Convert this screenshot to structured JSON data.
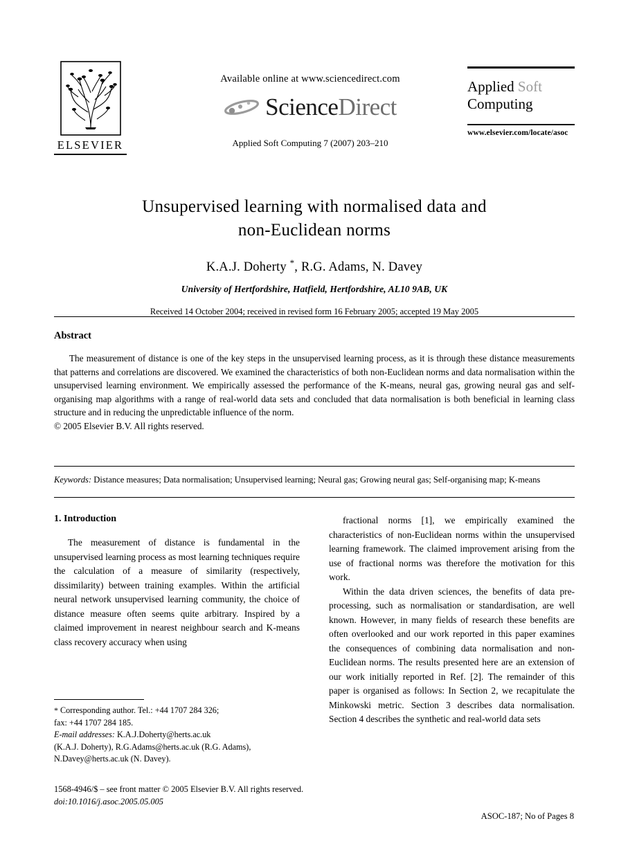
{
  "header": {
    "publisher": "ELSEVIER",
    "available_online": "Available online at www.sciencedirect.com",
    "sciencedirect_science": "Science",
    "sciencedirect_direct": "Direct",
    "journal_line": "Applied Soft Computing 7 (2007) 203–210",
    "journal_title_line1_bold": "Applied ",
    "journal_title_line1_grey": "Soft",
    "journal_title_line2": "Computing",
    "journal_url": "www.elsevier.com/locate/asoc"
  },
  "title": {
    "line1": "Unsupervised learning with normalised data and",
    "line2": "non-Euclidean norms"
  },
  "authors": {
    "text_before_star": "K.A.J. Doherty ",
    "star": "*",
    "text_after_star": ", R.G. Adams, N. Davey",
    "affiliation": "University of Hertfordshire, Hatfield, Hertfordshire, AL10 9AB, UK",
    "received": "Received 14 October 2004; received in revised form 16 February 2005; accepted 19 May 2005"
  },
  "abstract": {
    "heading": "Abstract",
    "body": "The measurement of distance is one of the key steps in the unsupervised learning process, as it is through these distance measurements that patterns and correlations are discovered. We examined the characteristics of both non-Euclidean norms and data normalisation within the unsupervised learning environment. We empirically assessed the performance of the K-means, neural gas, growing neural gas and self-organising map algorithms with a range of real-world data sets and concluded that data normalisation is both beneficial in learning class structure and in reducing the unpredictable influence of the norm.",
    "copyright": "© 2005 Elsevier B.V. All rights reserved."
  },
  "keywords": {
    "label": "Keywords:",
    "value": "Distance measures; Data normalisation; Unsupervised learning; Neural gas; Growing neural gas; Self-organising map; K-means"
  },
  "body": {
    "section_heading": "1. Introduction",
    "left_para_1": "The measurement of distance is fundamental in the unsupervised learning process as most learning techniques require the calculation of a measure of similarity (respectively, dissimilarity) between training examples. Within the artificial neural network unsupervised learning community, the choice of distance measure often seems quite arbitrary. Inspired by a claimed improvement in nearest neighbour search and K-means class recovery accuracy when using",
    "right_para_1": "fractional norms [1], we empirically examined the characteristics of non-Euclidean norms within the unsupervised learning framework. The claimed improvement arising from the use of fractional norms was therefore the motivation for this work.",
    "right_para_2": "Within the data driven sciences, the benefits of data pre-processing, such as normalisation or standardisation, are well known. However, in many fields of research these benefits are often overlooked and our work reported in this paper examines the consequences of combining data normalisation and non-Euclidean norms. The results presented here are an extension of our work initially reported in Ref. [2]. The remainder of this paper is organised as follows: In Section 2, we recapitulate the Minkowski metric. Section 3 describes data normalisation. Section 4 describes the synthetic and real-world data sets"
  },
  "footnote": {
    "star": "*",
    "corresponding": "Corresponding author. Tel.: +44 1707 284 326;",
    "fax": "fax: +44 1707 284 185.",
    "email_label": "E-mail addresses:",
    "email_1": "K.A.J.Doherty@herts.ac.uk",
    "email_1_owner": "(K.A.J. Doherty),",
    "email_2": "R.G.Adams@herts.ac.uk (R.G. Adams),",
    "email_3": "N.Davey@herts.ac.uk (N. Davey)."
  },
  "footer": {
    "issn_line": "1568-4946/$ – see front matter © 2005 Elsevier B.V. All rights reserved.",
    "doi_line": "doi:10.1016/j.asoc.2005.05.005",
    "article_id": "ASOC-187; No of Pages 8"
  }
}
